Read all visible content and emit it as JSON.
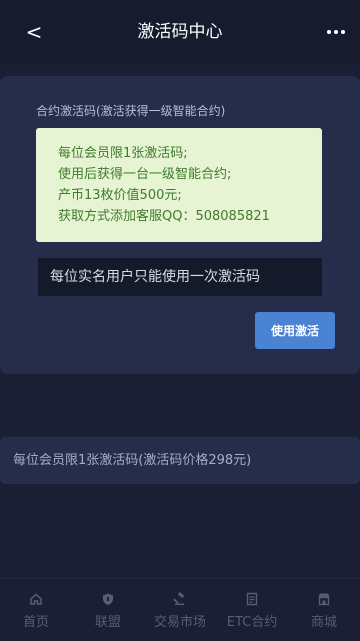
{
  "header": {
    "title": "激活码中心",
    "back_glyph": "<",
    "more_icon": "more-dots-icon"
  },
  "card": {
    "title": "合约激活码(激活获得一级智能合约)",
    "notice_lines": [
      "每位会员限1张激活码;",
      "使用后获得一台一级智能合约;",
      "产币13枚价值500元;",
      "获取方式添加客服QQ：508085821"
    ],
    "input_placeholder": "每位实名用户只能使用一次激活码",
    "activate_label": "使用激活"
  },
  "info_bar": {
    "text": "每位会员限1张激活码(激活码价格298元)"
  },
  "tabbar": {
    "items": [
      {
        "label": "首页",
        "icon": "home-icon"
      },
      {
        "label": "联盟",
        "icon": "shield-icon"
      },
      {
        "label": "交易市场",
        "icon": "gavel-icon"
      },
      {
        "label": "ETC合约",
        "icon": "contract-icon"
      },
      {
        "label": "商城",
        "icon": "store-icon"
      }
    ]
  },
  "colors": {
    "background": "#1a1f33",
    "card": "#262d4b",
    "notice_bg": "#e6f4d4",
    "notice_text": "#3f7b2a",
    "button": "#4a82d4",
    "tab_inactive": "#575d78"
  }
}
